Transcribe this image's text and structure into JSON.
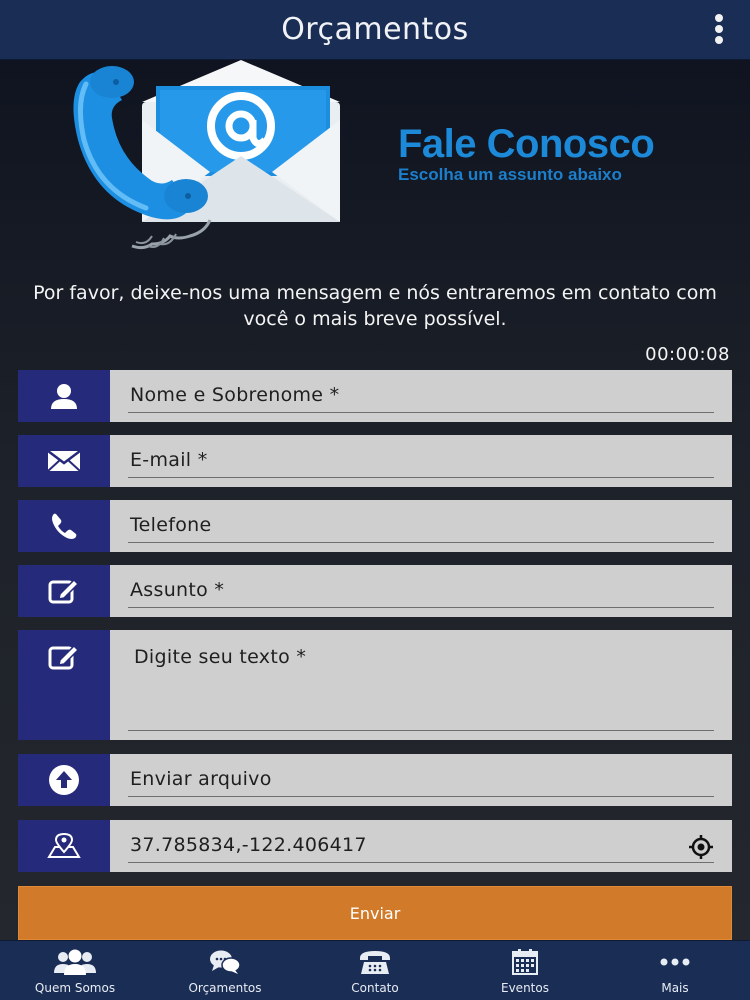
{
  "header": {
    "title": "Orçamentos",
    "menu_icon": "more-vertical-icon"
  },
  "banner": {
    "title": "Fale Conosco",
    "subtitle": "Escolha um assunto abaixo"
  },
  "intro_text": "Por favor, deixe-nos uma mensagem e nós entraremos em contato com você o mais breve possível.",
  "timer": "00:00:08",
  "form": {
    "name": {
      "placeholder": "Nome e Sobrenome *",
      "icon": "user-icon"
    },
    "email": {
      "placeholder": "E-mail *",
      "icon": "envelope-icon"
    },
    "phone": {
      "placeholder": "Telefone",
      "icon": "phone-icon"
    },
    "subject": {
      "placeholder": "Assunto *",
      "icon": "edit-icon"
    },
    "message": {
      "placeholder": "Digite seu texto *",
      "icon": "edit-icon"
    },
    "attachment": {
      "label": "Enviar arquivo",
      "icon": "upload-icon"
    },
    "location": {
      "value": "37.785834,-122.406417",
      "icon": "map-pin-icon",
      "locate_icon": "crosshair-icon"
    },
    "submit_label": "Enviar"
  },
  "tabs": [
    {
      "label": "Quem Somos",
      "icon": "users-icon"
    },
    {
      "label": "Orçamentos",
      "icon": "chat-icon"
    },
    {
      "label": "Contato",
      "icon": "telephone-icon"
    },
    {
      "label": "Eventos",
      "icon": "calendar-icon"
    },
    {
      "label": "Mais",
      "icon": "more-horizontal-icon"
    }
  ],
  "colors": {
    "header": "#1a2d55",
    "accent_blue": "#1c8ad9",
    "field_icon_bg": "#262a7a",
    "field_bg": "#cfcfcf",
    "submit": "#d17a2a"
  }
}
